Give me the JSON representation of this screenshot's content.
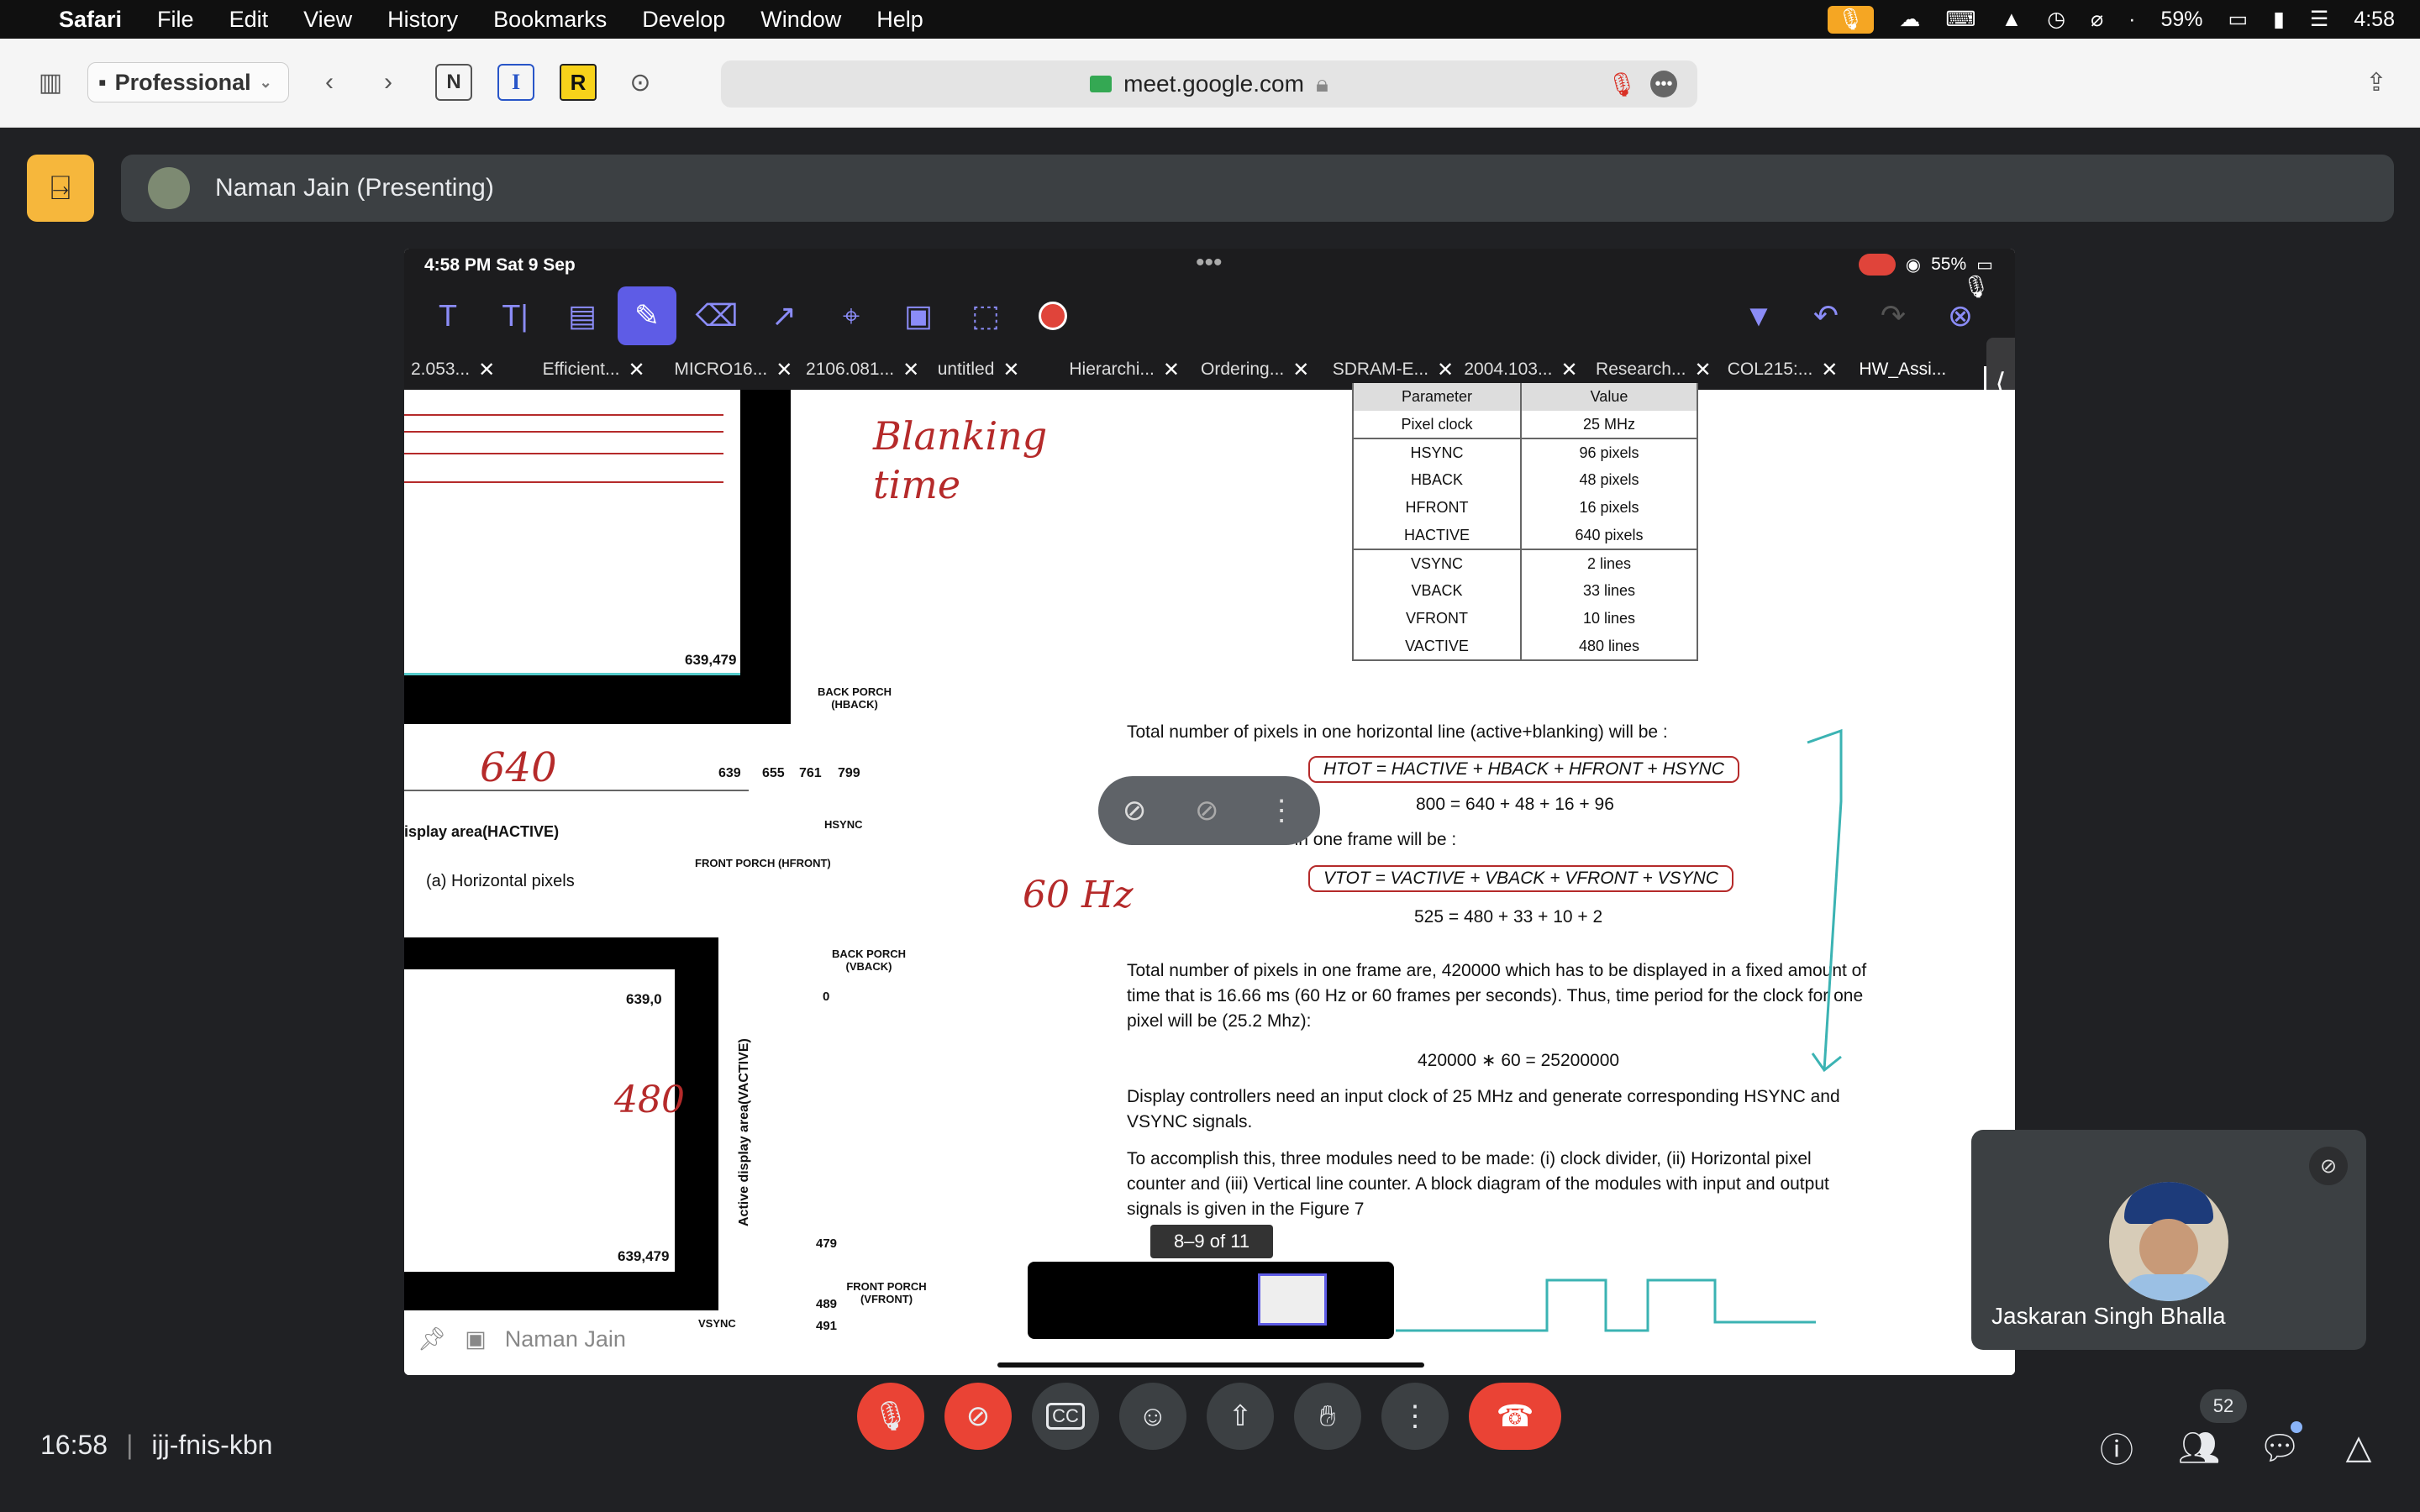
{
  "menubar": {
    "app": "Safari",
    "items": [
      "File",
      "Edit",
      "View",
      "History",
      "Bookmarks",
      "Develop",
      "Window",
      "Help"
    ],
    "battery": "59%",
    "clock": "4:58"
  },
  "safari": {
    "profile": "Professional",
    "url": "meet.google.com"
  },
  "meet": {
    "presenter": "Naman Jain (Presenting)",
    "self_name": "Jaskaran Singh Bhalla",
    "time": "16:58",
    "meeting_code": "ijj-fnis-kbn",
    "participants_count": "52"
  },
  "ipad": {
    "status_time": "4:58 PM  Sat 9 Sep",
    "battery": "55%",
    "tabs": [
      "2.053...",
      "Efficient...",
      "MICRO16...",
      "2106.081...",
      "untitled",
      "Hierarchi...",
      "Ordering...",
      "SDRAM-E...",
      "2004.103...",
      "Research...",
      "COL215:...",
      "HW_Assi..."
    ],
    "page_indicator": "8–9 of 11",
    "footer_name": "Naman Jain"
  },
  "doc": {
    "table_header": [
      "Parameter",
      "Value"
    ],
    "table_rows": [
      [
        "Pixel clock",
        "25 MHz"
      ],
      [
        "HSYNC",
        "96 pixels"
      ],
      [
        "HBACK",
        "48 pixels"
      ],
      [
        "HFRONT",
        "16 pixels"
      ],
      [
        "HACTIVE",
        "640 pixels"
      ],
      [
        "VSYNC",
        "2 lines"
      ],
      [
        "VBACK",
        "33 lines"
      ],
      [
        "VFRONT",
        "10 lines"
      ],
      [
        "VACTIVE",
        "480 lines"
      ]
    ],
    "line_htot_intro": "Total number of pixels in one horizontal line (active+blanking) will be :",
    "htot_formula": "HTOT = HACTIVE + HBACK + HFRONT + HSYNC",
    "htot_value": "800 = 640 + 48 + 16 + 96",
    "vtot_intro": "Total number of lines in one frame will be :",
    "vtot_formula": "VTOT = VACTIVE + VBACK + VFRONT + VSYNC",
    "vtot_value": "525 = 480 + 33 + 10 + 2",
    "frame_para_1": "Total number of pixels in one frame are, 420000 which has to be displayed in a fixed amount of",
    "frame_para_2": "time that is 16.66 ms (60 Hz or 60 frames per seconds). Thus, time period for the clock for one",
    "frame_para_3": "pixel will be (25.2 Mhz):",
    "product": "420000 ∗ 60 = 25200000",
    "disp_para_1": "Display controllers need an input clock of 25 MHz and generate corresponding HSYNC and",
    "disp_para_2": "VSYNC signals.",
    "acc_para_1": "To accomplish this, three modules need to be made: (i) clock divider, (ii) Horizontal pixel",
    "acc_para_2": "counter and (iii) Vertical line counter. A block diagram of the modules with input and output",
    "acc_para_3": "signals is given in the Figure 7",
    "coord_639_479_a": "639,479",
    "coord_639_0": "639,0",
    "coord_639_479_b": "639,479",
    "back_porch_h": "BACK PORCH (HBACK)",
    "front_porch_h": "FRONT PORCH (HFRONT)",
    "hsync_label": "HSYNC",
    "hactive_label": "isplay area(HACTIVE)",
    "caption_a": "(a) Horizontal pixels",
    "ticks_h": [
      "639",
      "655",
      "761",
      "799"
    ],
    "back_porch_v": "BACK PORCH (VBACK)",
    "front_porch_v": "FRONT PORCH (VFRONT)",
    "vactive_label": "Active display area(VACTIVE)",
    "vsync_label": "VSYNC",
    "ticks_v": [
      "0",
      "479",
      "489",
      "491"
    ],
    "hand_640": "640",
    "hand_480": "480",
    "hand_blanking": "Blanking time",
    "hand_60hz": "60 Hz"
  }
}
